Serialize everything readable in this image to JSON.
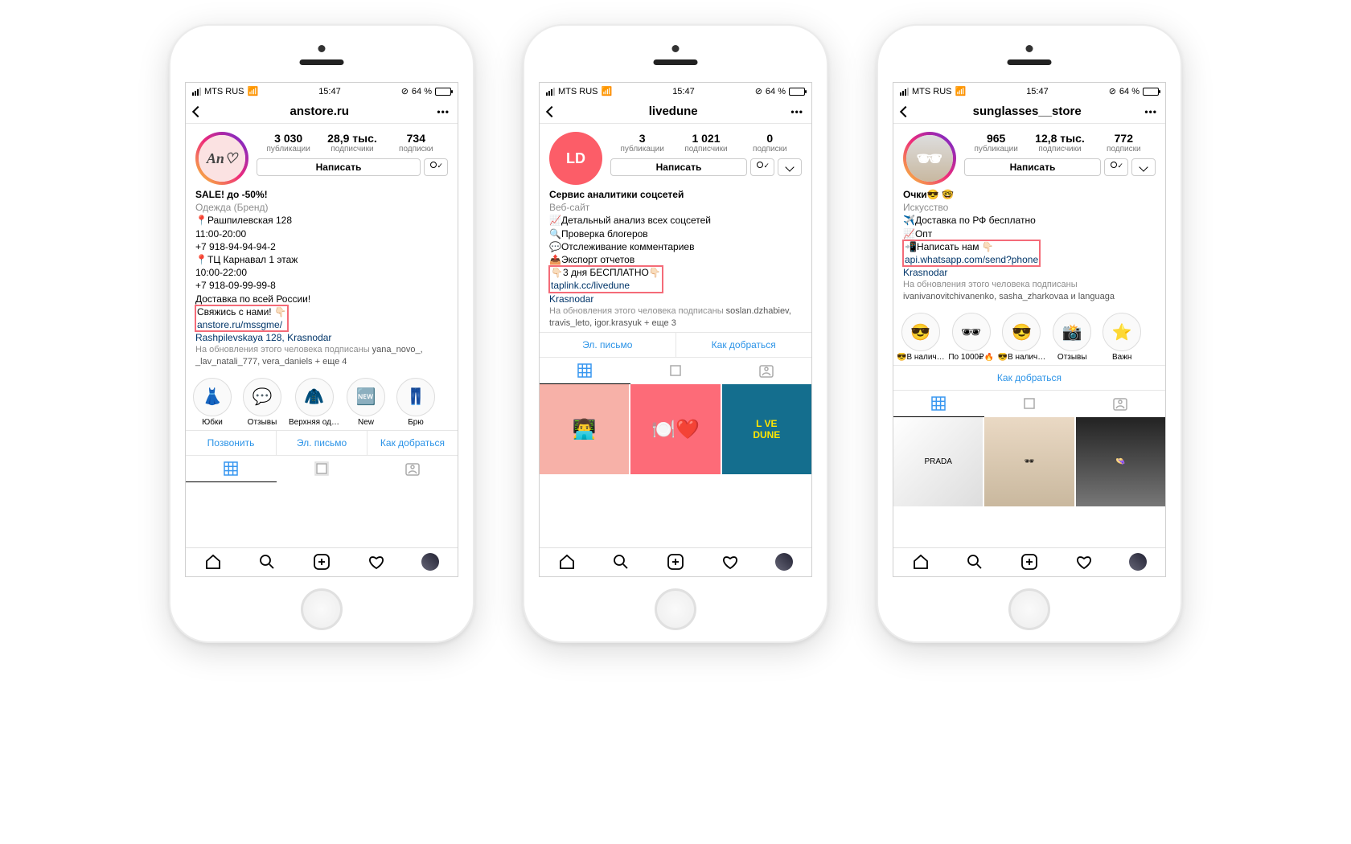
{
  "statusBar": {
    "carrier": "MTS RUS",
    "time": "15:47",
    "battery": "64 %"
  },
  "phones": [
    {
      "username": "anstore.ru",
      "avatarText": "An♡",
      "avatarBg": "#fbe2e2",
      "avatarFg": "#444",
      "hasStory": true,
      "stats": [
        {
          "num": "3 030",
          "lbl": "публикации"
        },
        {
          "num": "28,9 тыс.",
          "lbl": "подписчики"
        },
        {
          "num": "734",
          "lbl": "подписки"
        }
      ],
      "writeBtn": "Написать",
      "bioName": "SALE! до -50%!",
      "bioCat": "Одежда (Бренд)",
      "bioLines": [
        "📍Рашпилевская 128",
        "11:00-20:00",
        "+7 918-94-94-94-2",
        "📍ТЦ Карнавал 1 этаж",
        "10:00-22:00",
        "+7 918-09-99-99-8",
        "Доставка по всей России!"
      ],
      "contactLine": "Свяжись с нами! 👇🏻",
      "linkLine": "anstore.ru/mssgme/",
      "locLine": "Rashpilevskaya 128, Krasnodar",
      "followedLabel": "На обновления этого человека подписаны",
      "followedNames": "yana_novo_, _lav_natali_777, vera_daniels + еще 4",
      "highlights": [
        {
          "emoji": "👗",
          "lbl": "Юбки"
        },
        {
          "emoji": "💬",
          "lbl": "Отзывы"
        },
        {
          "emoji": "🧥",
          "lbl": "Верхняя од…"
        },
        {
          "emoji": "🆕",
          "lbl": "New"
        },
        {
          "emoji": "👖",
          "lbl": "Брю"
        }
      ],
      "actions": [
        "Позвонить",
        "Эл. письмо",
        "Как добраться"
      ],
      "gridColors": [
        "#eee",
        "#eee",
        "#eee"
      ]
    },
    {
      "username": "livedune",
      "avatarText": "LD",
      "avatarBg": "#fc5d68",
      "avatarFg": "#fff",
      "hasStory": false,
      "stats": [
        {
          "num": "3",
          "lbl": "публикации"
        },
        {
          "num": "1 021",
          "lbl": "подписчики"
        },
        {
          "num": "0",
          "lbl": "подписки"
        }
      ],
      "writeBtn": "Написать",
      "bioName": "Сервис аналитики соцсетей",
      "bioCat": "Веб-сайт",
      "bioLines": [
        "📈Детальный анализ всех соцсетей",
        "🔍Проверка блогеров",
        "💬Отслеживание комментариев",
        "📤Экспорт отчетов"
      ],
      "contactLine": "👇🏻3 дня БЕСПЛАТНО👇🏻",
      "linkLine": "taplink.cc/livedune",
      "locLine": "Krasnodar",
      "followedLabel": "На обновления этого человека подписаны",
      "followedNames": "soslan.dzhabiev, travis_leto, igor.krasyuk + еще 3",
      "highlights": null,
      "actions": [
        "Эл. письмо",
        "Как добраться"
      ],
      "gridColors": [
        "#f7b1a8",
        "#fd6b78",
        "#1d91b5"
      ],
      "gridLabels": [
        "",
        "",
        "L VE\nDUNE"
      ]
    },
    {
      "username": "sunglasses__store",
      "avatarText": "",
      "avatarBg": "#e8d8c8",
      "avatarFg": "#333",
      "hasStory": true,
      "stats": [
        {
          "num": "965",
          "lbl": "публикации"
        },
        {
          "num": "12,8 тыс.",
          "lbl": "подписчики"
        },
        {
          "num": "772",
          "lbl": "подписки"
        }
      ],
      "writeBtn": "Написать",
      "bioName": "Очки😎 🤓",
      "bioCat": "Искусство",
      "bioLines": [
        "✈️Доставка по РФ бесплатно",
        "📈Опт"
      ],
      "contactLine": "📲Написать нам 👇🏻",
      "linkLine": "api.whatsapp.com/send?phone",
      "locLine": "Krasnodar",
      "followedLabel": "На обновления этого человека подписаны",
      "followedNames": "ivanivanovitchivanenko, sasha_zharkоvaa и languaga",
      "highlights": [
        {
          "emoji": "😎",
          "lbl": "😎В налич…"
        },
        {
          "emoji": "🕶",
          "lbl": "По 1000₽🔥"
        },
        {
          "emoji": "😎",
          "lbl": "😎В налич…"
        },
        {
          "emoji": "📸",
          "lbl": "Отзывы"
        },
        {
          "emoji": "⭐",
          "lbl": "Важн"
        }
      ],
      "actions": [
        "Как добраться"
      ],
      "gridColors": [
        "#efefef",
        "#ead9c4",
        "#e2e2e2"
      ]
    }
  ]
}
